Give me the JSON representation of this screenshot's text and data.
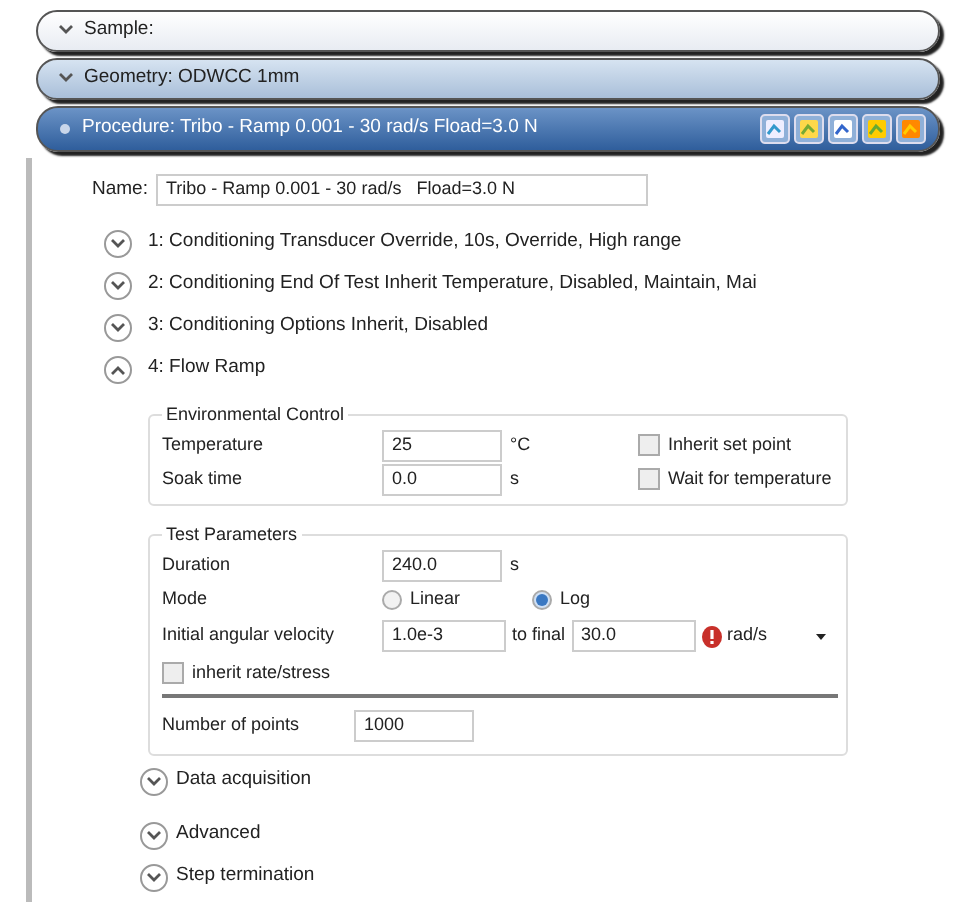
{
  "headers": [
    {
      "label": "Sample:",
      "kind": "plain",
      "expanded": false
    },
    {
      "label": "Geometry: ODWCC 1mm",
      "kind": "tinted",
      "expanded": false
    },
    {
      "label": "Procedure: Tribo - Ramp 0.001 - 30 rad/s   Fload=3.0 N",
      "kind": "active",
      "expanded": true
    }
  ],
  "name": {
    "label": "Name:",
    "value": "Tribo - Ramp 0.001 - 30 rad/s   Fload=3.0 N"
  },
  "steps": [
    {
      "label": "1: Conditioning Transducer Override, 10s, Override, High range",
      "expanded": false
    },
    {
      "label": "2: Conditioning End Of Test Inherit Temperature, Disabled, Maintain, Mai",
      "expanded": false
    },
    {
      "label": "3: Conditioning Options Inherit, Disabled",
      "expanded": false
    },
    {
      "label": "4: Flow Ramp",
      "expanded": true
    }
  ],
  "environmental_control": {
    "title": "Environmental Control",
    "rows": [
      {
        "label": "Temperature",
        "value": "25",
        "unit": "°C",
        "checkbox": {
          "label": "Inherit set point",
          "checked": false
        }
      },
      {
        "label": "Soak time",
        "value": "0.0",
        "unit": "s",
        "checkbox": {
          "label": "Wait for temperature",
          "checked": false
        }
      }
    ]
  },
  "test_parameters": {
    "title": "Test Parameters",
    "duration": {
      "label": "Duration",
      "value": "240.0",
      "unit": "s"
    },
    "mode": {
      "label": "Mode",
      "options": [
        {
          "label": "Linear",
          "selected": false
        },
        {
          "label": "Log",
          "selected": true
        }
      ]
    },
    "velocity": {
      "label": "Initial angular velocity",
      "value": "1.0e-3",
      "to_label": "to final",
      "final_value": "30.0",
      "warning": true,
      "unit": "rad/s"
    },
    "inherit": {
      "label": "inherit rate/stress",
      "checked": false
    },
    "points": {
      "label": "Number of points",
      "value": "1000"
    }
  },
  "sections": [
    {
      "label": "Data acquisition",
      "expanded": false
    },
    {
      "label": "Advanced",
      "expanded": false
    },
    {
      "label": "Step termination",
      "expanded": false
    }
  ]
}
